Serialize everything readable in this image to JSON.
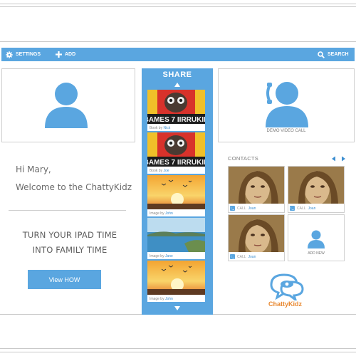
{
  "toolbar": {
    "settings_label": "SETTINGS",
    "add_label": "ADD",
    "search_label": "SEARCH"
  },
  "left": {
    "greeting": "Hi Mary,",
    "welcome": "Welcome to the ChattyKidz",
    "tagline_1": "TURN YOUR IPAD TIME",
    "tagline_2": "INTO FAMILY TIME",
    "view_button": "View HOW"
  },
  "share": {
    "title": "SHARE",
    "items": [
      {
        "type": "Book",
        "by": "by",
        "name": "Nick"
      },
      {
        "type": "Book",
        "by": "by",
        "name": "Joe"
      },
      {
        "type": "Image",
        "by": "by",
        "name": "John"
      },
      {
        "type": "Image",
        "by": "by",
        "name": "Jane"
      },
      {
        "type": "Image",
        "by": "by",
        "name": "John"
      }
    ]
  },
  "right": {
    "demo_label": "DEMO VIDEO CALL",
    "contacts_label": "CONTACTS",
    "contacts": [
      {
        "call": "CALL",
        "name": "Joan"
      },
      {
        "call": "CALL",
        "name": "Joan"
      },
      {
        "call": "CALL",
        "name": "Joan"
      }
    ],
    "add_new_label": "ADD NEW",
    "brand": "ChattyKidz"
  },
  "colors": {
    "accent": "#5aa6e0",
    "brand_orange": "#e8872e"
  }
}
